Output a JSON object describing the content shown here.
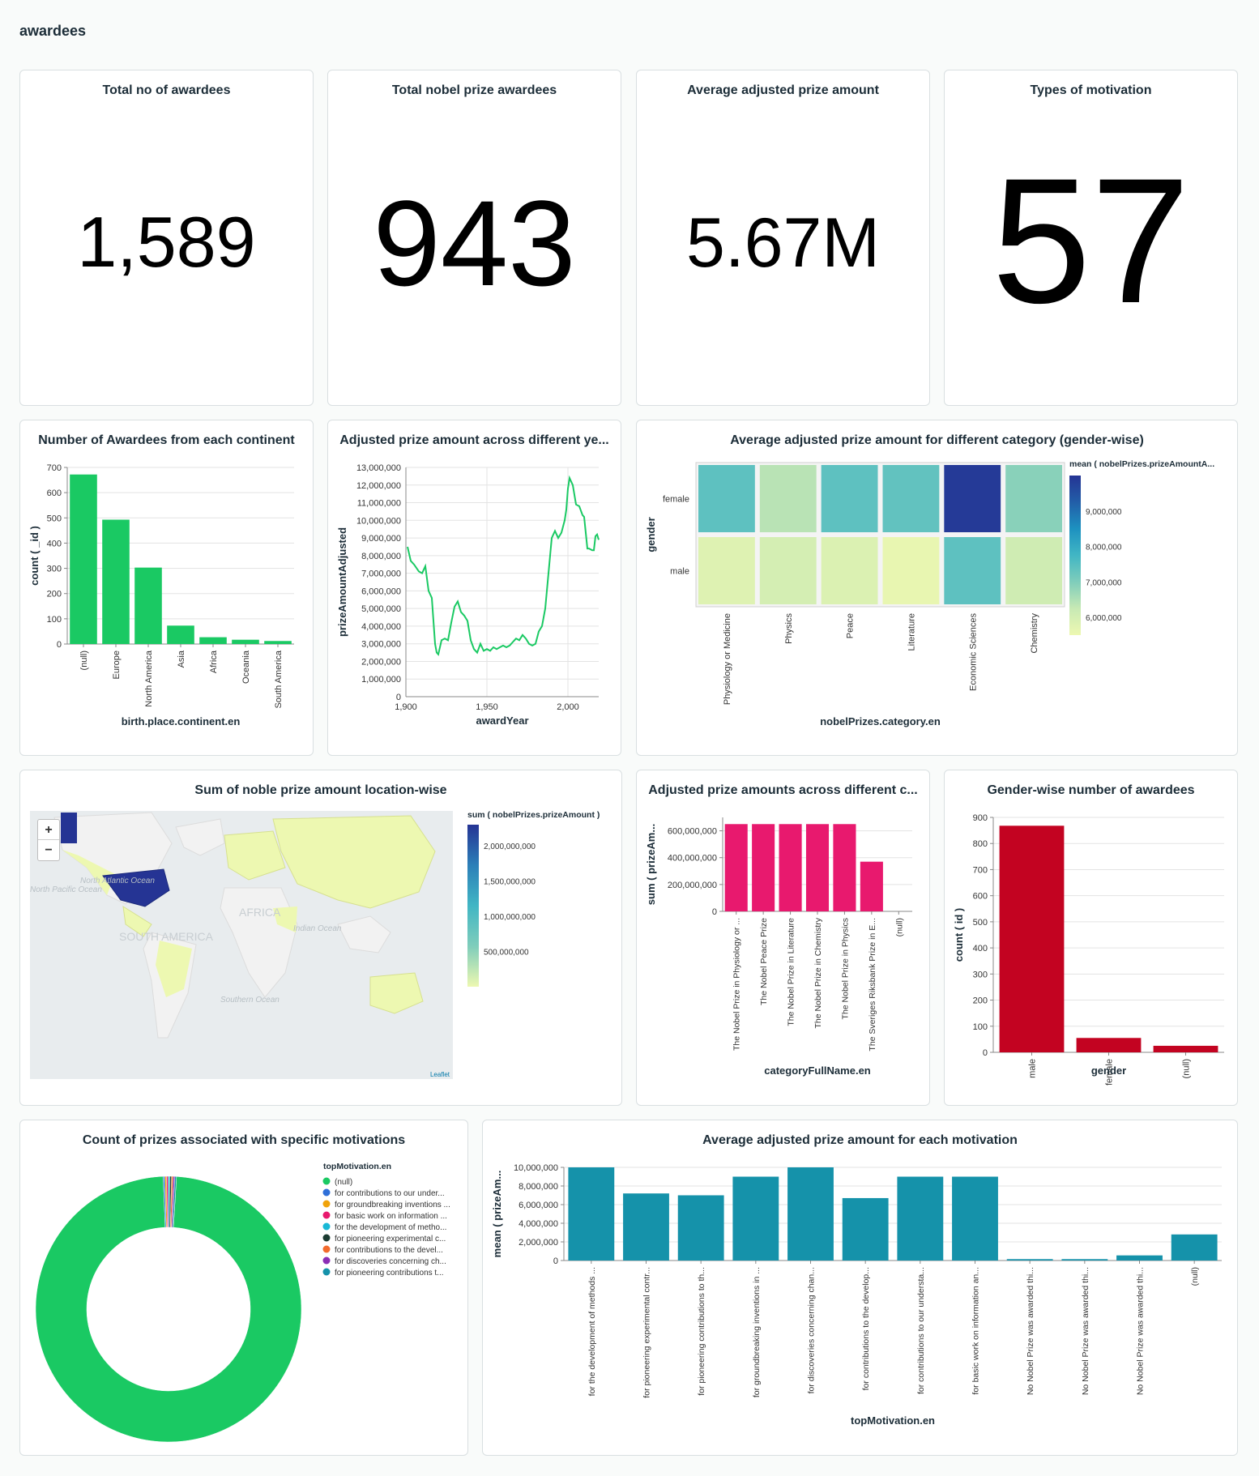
{
  "dashboard": {
    "title": "awardees"
  },
  "kpis": [
    {
      "title": "Total no of awardees",
      "value": "1,589"
    },
    {
      "title": "Total nobel prize awardees",
      "value": "943"
    },
    {
      "title": "Average adjusted prize amount",
      "value": "5.67M"
    },
    {
      "title": "Types of motivation",
      "value": "57"
    }
  ],
  "cards": {
    "continent": "Number of Awardees from each continent",
    "yearLine": "Adjusted prize amount across different ye...",
    "heatmap": "Average adjusted prize amount for different category (gender-wise)",
    "map": "Sum of noble prize amount location-wise",
    "categoryBar": "Adjusted prize amounts across different c...",
    "gender": "Gender-wise number of awardees",
    "donut": "Count of prizes associated with specific motivations",
    "motivation": "Average adjusted prize amount for each motivation"
  },
  "map": {
    "zoom_in": "+",
    "zoom_out": "−",
    "attribution": "Leaflet",
    "legend_title": "sum ( nobelPrizes.prizeAmount )",
    "legend_ticks": [
      "2,000,000,000",
      "1,500,000,000",
      "1,000,000,000",
      "500,000,000"
    ],
    "labels": [
      "North Atlantic Ocean",
      "North Pacific Ocean",
      "SOUTH AMERICA",
      "AFRICA",
      "Indian Ocean",
      "Southern Ocean"
    ],
    "colors": {
      "high": "#253494",
      "mid": "#2c7fb8",
      "low": "#edf8b1",
      "land": "#f2f2f2",
      "ocean": "#e8ecee"
    }
  },
  "colors": {
    "green": "#1ac963",
    "teal": "#1592aa",
    "pink": "#e8196e",
    "red": "#c30321",
    "line": "#1ac963"
  },
  "chart_data": [
    {
      "id": "continent",
      "type": "bar",
      "categories": [
        "(null)",
        "Europe",
        "North America",
        "Asia",
        "Africa",
        "Oceania",
        "South America"
      ],
      "values": [
        672,
        493,
        303,
        73,
        27,
        17,
        12
      ],
      "xlabel": "birth.place.continent.en",
      "ylabel": "count ( _id )",
      "yticks": [
        "0",
        "100",
        "200",
        "300",
        "400",
        "500",
        "600",
        "700"
      ],
      "ylim": [
        0,
        700
      ],
      "grid": true
    },
    {
      "id": "yearLine",
      "type": "line",
      "xlabel": "awardYear",
      "ylabel": "prizeAmountAdjusted",
      "xticks": [
        "1,900",
        "1,950",
        "2,000"
      ],
      "yticks": [
        "0",
        "1,000,000",
        "2,000,000",
        "3,000,000",
        "4,000,000",
        "5,000,000",
        "6,000,000",
        "7,000,000",
        "8,000,000",
        "9,000,000",
        "10,000,000",
        "11,000,000",
        "12,000,000",
        "13,000,000"
      ],
      "xlim": [
        1900,
        2019
      ],
      "ylim": [
        0,
        13000000
      ],
      "x": [
        1901,
        1903,
        1905,
        1908,
        1910,
        1912,
        1914,
        1916,
        1918,
        1919,
        1920,
        1922,
        1924,
        1926,
        1928,
        1930,
        1932,
        1934,
        1936,
        1938,
        1940,
        1942,
        1944,
        1946,
        1948,
        1950,
        1952,
        1954,
        1956,
        1958,
        1960,
        1962,
        1964,
        1966,
        1968,
        1970,
        1972,
        1974,
        1976,
        1978,
        1980,
        1982,
        1984,
        1986,
        1988,
        1990,
        1992,
        1994,
        1996,
        1998,
        1999,
        2000,
        2001,
        2003,
        2005,
        2007,
        2009,
        2010,
        2012,
        2013,
        2015,
        2016,
        2017,
        2018,
        2019
      ],
      "values": [
        8500000,
        7700000,
        7500000,
        7100000,
        7000000,
        7400000,
        6000000,
        5600000,
        3000000,
        2500000,
        2400000,
        3200000,
        3300000,
        3200000,
        4200000,
        5100000,
        5400000,
        4800000,
        4600000,
        4300000,
        3200000,
        2700000,
        2500000,
        3000000,
        2600000,
        2700000,
        2600000,
        2800000,
        2700000,
        2800000,
        2900000,
        2800000,
        2900000,
        3100000,
        3300000,
        3200000,
        3500000,
        3300000,
        3000000,
        2900000,
        3000000,
        3700000,
        4000000,
        5000000,
        7000000,
        9000000,
        9400000,
        9000000,
        9300000,
        10000000,
        10600000,
        11800000,
        12400000,
        12000000,
        10900000,
        10800000,
        10300000,
        10200000,
        8400000,
        8400000,
        8300000,
        8300000,
        9100000,
        9200000,
        8900000
      ],
      "grid": true
    },
    {
      "id": "heatmap",
      "type": "heatmap",
      "xlabel": "nobelPrizes.category.en",
      "ylabel": "gender",
      "x": [
        "Physiology or Medicine",
        "Physics",
        "Peace",
        "Literature",
        "Economic Sciences",
        "Chemistry"
      ],
      "y": [
        "female",
        "male"
      ],
      "values": [
        [
          7400000,
          6400000,
          7400000,
          7350000,
          9900000,
          6900000
        ],
        [
          5800000,
          6000000,
          5850000,
          5600000,
          7400000,
          6100000
        ]
      ],
      "legend_title": "mean ( nobelPrizes.prizeAmountA...",
      "legend_ticks": [
        "9,000,000",
        "8,000,000",
        "7,000,000",
        "6,000,000"
      ],
      "range": [
        5500000,
        10000000
      ]
    },
    {
      "id": "categoryBar",
      "type": "bar",
      "categories": [
        "The Nobel Prize in Physiology or ...",
        "The Nobel Peace Prize",
        "The Nobel Prize in  Literature",
        "The Nobel Prize in Chemistry",
        "The Nobel Prize in Physics",
        "The Sveriges Riksbank Prize in E...",
        "(null)"
      ],
      "values": [
        650000000,
        650000000,
        650000000,
        650000000,
        650000000,
        370000000,
        0
      ],
      "xlabel": "categoryFullName.en",
      "ylabel": "sum ( prizeAm...",
      "yticks": [
        "0",
        "200,000,000",
        "400,000,000",
        "600,000,000"
      ],
      "ylim": [
        0,
        700000000
      ],
      "grid": true
    },
    {
      "id": "gender",
      "type": "bar",
      "categories": [
        "male",
        "female",
        "(null)"
      ],
      "values": [
        868,
        55,
        25
      ],
      "xlabel": "gender",
      "ylabel": "count ( id )",
      "yticks": [
        "0",
        "100",
        "200",
        "300",
        "400",
        "500",
        "600",
        "700",
        "800",
        "900"
      ],
      "ylim": [
        0,
        900
      ],
      "grid": true
    },
    {
      "id": "donut",
      "type": "pie",
      "legend_title": "topMotivation.en",
      "series": [
        {
          "name": "(null)",
          "value": 98.5,
          "color": "#1ac963"
        },
        {
          "name": "for contributions to our under...",
          "value": 0.2,
          "color": "#2f6fd8"
        },
        {
          "name": "for groundbreaking inventions ...",
          "value": 0.2,
          "color": "#f0a30a"
        },
        {
          "name": "for basic work on information ...",
          "value": 0.2,
          "color": "#e8196e"
        },
        {
          "name": "for the development of metho...",
          "value": 0.2,
          "color": "#19b9d6"
        },
        {
          "name": "for pioneering experimental c...",
          "value": 0.2,
          "color": "#1c3d33"
        },
        {
          "name": "for contributions to the devel...",
          "value": 0.2,
          "color": "#f26b2d"
        },
        {
          "name": "for discoveries concerning ch...",
          "value": 0.2,
          "color": "#8b2db5"
        },
        {
          "name": "for pioneering contributions t...",
          "value": 0.2,
          "color": "#1592aa"
        }
      ]
    },
    {
      "id": "motivation",
      "type": "bar",
      "categories": [
        "for the development of methods ...",
        "for pioneering experimental contr...",
        "for pioneering contributions to th...",
        "for groundbreaking inventions in ...",
        "for discoveries concerning chan...",
        "for contributions to the develop...",
        "for contributions to our understa...",
        "for basic work on information an...",
        "No Nobel Prize was awarded thi...",
        "No Nobel Prize was awarded thi...",
        "No Nobel Prize was awarded thi...",
        "(null)"
      ],
      "values": [
        10000000,
        7200000,
        7000000,
        9000000,
        10000000,
        6700000,
        9000000,
        9000000,
        150000,
        150000,
        550000,
        2800000
      ],
      "xlabel": "topMotivation.en",
      "ylabel": "mean ( prizeAm...",
      "yticks": [
        "0",
        "2,000,000",
        "4,000,000",
        "6,000,000",
        "8,000,000",
        "10,000,000"
      ],
      "ylim": [
        0,
        10000000
      ],
      "grid": true
    }
  ]
}
